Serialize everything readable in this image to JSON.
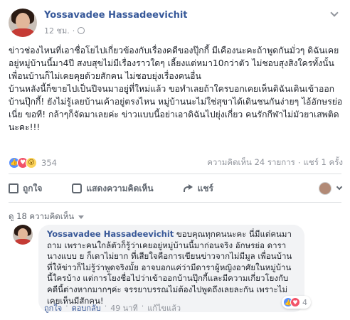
{
  "post": {
    "author": "Yossavadee Hassadeevichit",
    "time": "12 ชม.",
    "dot": "·",
    "text": "ข่าวช่องไหนที่เอาชื่อโยไปเกี่ยวข้องกับเรื่องคดีของปุ๊กกี้ มีเคืองนะคะถ้าพูดกันมั่วๆ ดิฉันเคยอยู่หมู่บ้านนี้มา4ปี สงบสุขไม่มีเรื่องราวใดๆ เลี้ยงแต่หมา10กว่าตัว ไม่ชอบสุงสิงใครทั้งนั้น เพื่อนบ้านก็ไม่เคยคุยด้วยสักคน ไม่ชอบยุ่งเรื่องคนอื่น\nบ้านหลังนี้ก็ขายไปเป็นปีจนมาอยู่ที่ใหม่แล้ว ขอทำเลยถ้าใครบอกเคยเห็นดิฉันเดินเข้าออกบ้านปุ๊กกี้! ยังไม่รู้เลยบ้านเค้าอยู่ตรงไหน หมู่บ้านนะไม่ใช่สุขาได้เดินชนกันง่ายๆ ไอ้อักษรย่อเนี่ย ขอที! กล้าๆก็จัดมาเลยค่ะ ข่าวแบบนี้อย่าเอาดิฉันไปยุ่งเกี่ยว คนรักกีฬาไม่มัวยาเสพติดนะคะ!!!",
    "reactions_count": "354",
    "comments_stat": "ความคิดเห็น 24 รายการ",
    "shares_stat": "แชร์ 1 ครั้ง",
    "stats_dot": "·"
  },
  "actions": {
    "like": "ถูกใจ",
    "comment": "แสดงความคิดเห็น",
    "share": "แชร์"
  },
  "comments": {
    "header": "ดู 18 ความคิดเห็น",
    "first": {
      "author": "Yossavadee Hassadeevichit",
      "text": "ขอบคุณทุกคนนะคะ นี่มีแต่คนมาถาม เพราะคนใกล้ตัวก็รู้ว่าเคยอยู่หมู่บ้านนี้มาก่อนจริง อักษรย่อ ดารานางแบบ ย ก็เดาไม่ยาก ที่เสียใจคือการเขียนข่าวจากไม่มีมูล เพื่อนบ้านที่ให้ข่าวก็ไม่รู้ว่าพูดจริงมั้ย อาจบอกแค่ว่ามีดาราผู้หญิงอาศัยในหมู่บ้านนี้ใครบ้าง แต่การโยงชื่อไปว่าเข้าออกบ้านปุ๊กกี้และมีความเกี่ยวโยงกับคดีนี้ต่างหากมากๆค่ะ จรรยาบรรณไม่ต้องไปพูดถึงเลยละกัน เพราะไม่เคยเห็นมีสักคน!",
      "reactions_count": "4",
      "like": "ถูกใจ",
      "reply": "ตอบกลับ",
      "time": "49 นาที",
      "edited": "แก้ไขแล้ว",
      "dot": "·"
    }
  },
  "colors": {
    "link": "#365899",
    "meta": "#90949c",
    "like": "#5890ff",
    "love": "#f25268",
    "wow": "#fcd45c"
  }
}
